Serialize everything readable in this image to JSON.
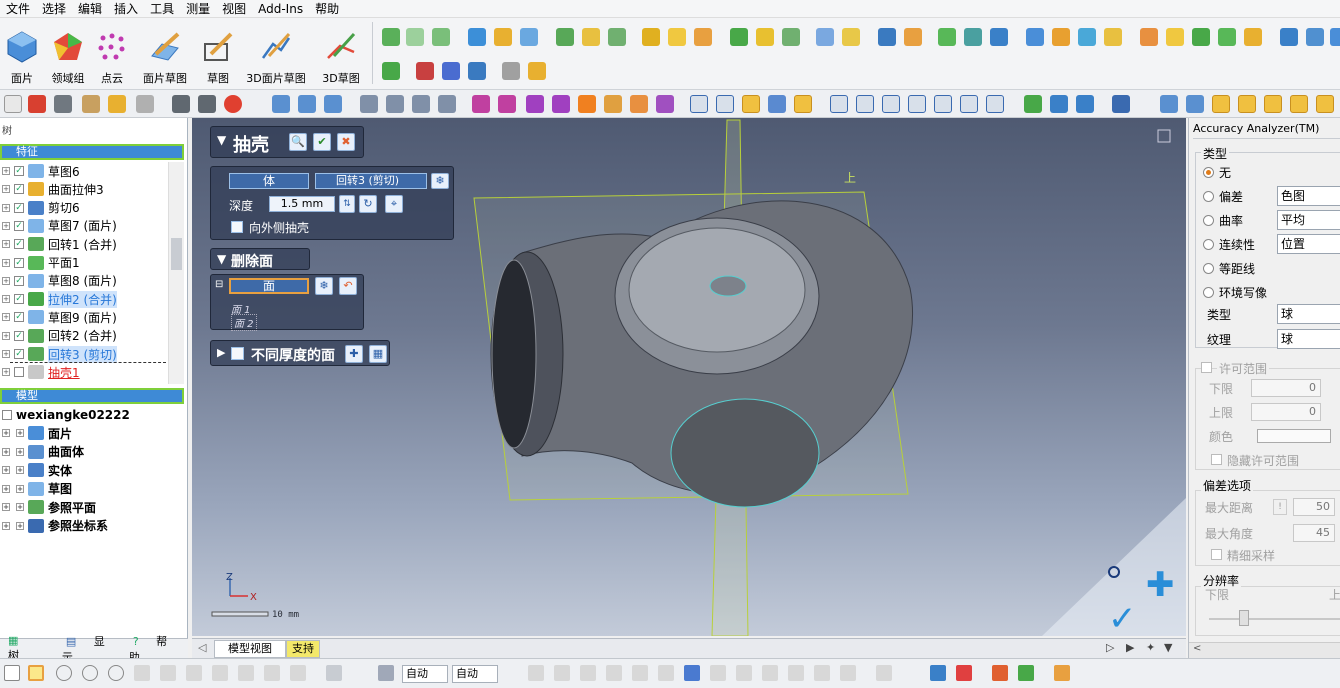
{
  "menu": [
    "文件",
    "选择",
    "编辑",
    "插入",
    "工具",
    "测量",
    "视图",
    "Add-Ins",
    "帮助"
  ],
  "ribbon": {
    "big_buttons": [
      "面片",
      "领域组",
      "点云",
      "面片草图",
      "草图",
      "3D面片草图",
      "3D草图"
    ]
  },
  "tree": {
    "features_header": "特征",
    "features": [
      {
        "label": "草图6",
        "checked": true,
        "selected": false
      },
      {
        "label": "曲面拉伸3",
        "checked": true,
        "selected": false
      },
      {
        "label": "剪切6",
        "checked": true,
        "selected": false
      },
      {
        "label": "草图7 (面片)",
        "checked": true,
        "selected": false
      },
      {
        "label": "回转1 (合并)",
        "checked": true,
        "selected": false
      },
      {
        "label": "平面1",
        "checked": true,
        "selected": false
      },
      {
        "label": "草图8 (面片)",
        "checked": true,
        "selected": false
      },
      {
        "label": "拉伸2 (合并)",
        "checked": true,
        "selected": true
      },
      {
        "label": "草图9 (面片)",
        "checked": true,
        "selected": false
      },
      {
        "label": "回转2 (合并)",
        "checked": true,
        "selected": false
      },
      {
        "label": "回转3 (剪切)",
        "checked": true,
        "selected": true
      },
      {
        "label": "抽壳1",
        "checked": false,
        "selected": false
      }
    ],
    "model_header": "模型",
    "model_root": "wexiangke02222",
    "model_items": [
      "面片",
      "曲面体",
      "实体",
      "草图",
      "参照平面",
      "参照坐标系"
    ]
  },
  "left_tabs": [
    "树",
    "显示",
    "帮助"
  ],
  "shell_panel": {
    "title": "抽壳",
    "body_label": "体",
    "body_value": "回转3 (剪切)",
    "depth_label": "深度",
    "depth_value": "1.5 mm",
    "outward_label": "向外侧抽壳",
    "remove_faces_title": "删除面",
    "face_label": "面",
    "faces": [
      "面 1",
      "面 2"
    ],
    "variable_thickness_label": "不同厚度的面"
  },
  "viewport": {
    "plane_label": "上",
    "scale_label": "10 mm"
  },
  "view_tabs": [
    "模型视图",
    "支持"
  ],
  "accuracy": {
    "title": "Accuracy Analyzer(TM)",
    "type_group": "类型",
    "options": [
      {
        "label": "无",
        "selected": true,
        "select_value": ""
      },
      {
        "label": "偏差",
        "selected": false,
        "select_value": "色图"
      },
      {
        "label": "曲率",
        "selected": false,
        "select_value": "平均"
      },
      {
        "label": "连续性",
        "selected": false,
        "select_value": "位置"
      },
      {
        "label": "等距线",
        "selected": false,
        "select_value": ""
      },
      {
        "label": "环境写像",
        "selected": false,
        "select_value": ""
      }
    ],
    "env_type_label": "类型",
    "env_type_value": "球",
    "texture_label": "纹理",
    "texture_value": "球",
    "tolerance_label": "许可范围",
    "lower_label": "下限",
    "lower_value": "0",
    "upper_label": "上限",
    "upper_value": "0",
    "color_label": "颜色",
    "hide_tolerance_label": "隐藏许可范围",
    "deviation_options": "偏差选项",
    "max_distance_label": "最大距离",
    "max_distance_value": "50",
    "max_angle_label": "最大角度",
    "max_angle_value": "45",
    "fine_sampling_label": "精细采样",
    "resolution_label": "分辨率",
    "res_lower": "下限",
    "res_upper": "上"
  },
  "status": {
    "combo1": "自动",
    "combo2": "自动"
  },
  "colors": {
    "panel_bg": "#303c55",
    "tree_header": "#3e8ad6",
    "header_border": "#7fcf3a",
    "selected_text": "#2878d8",
    "accent_orange": "#e07b18"
  }
}
